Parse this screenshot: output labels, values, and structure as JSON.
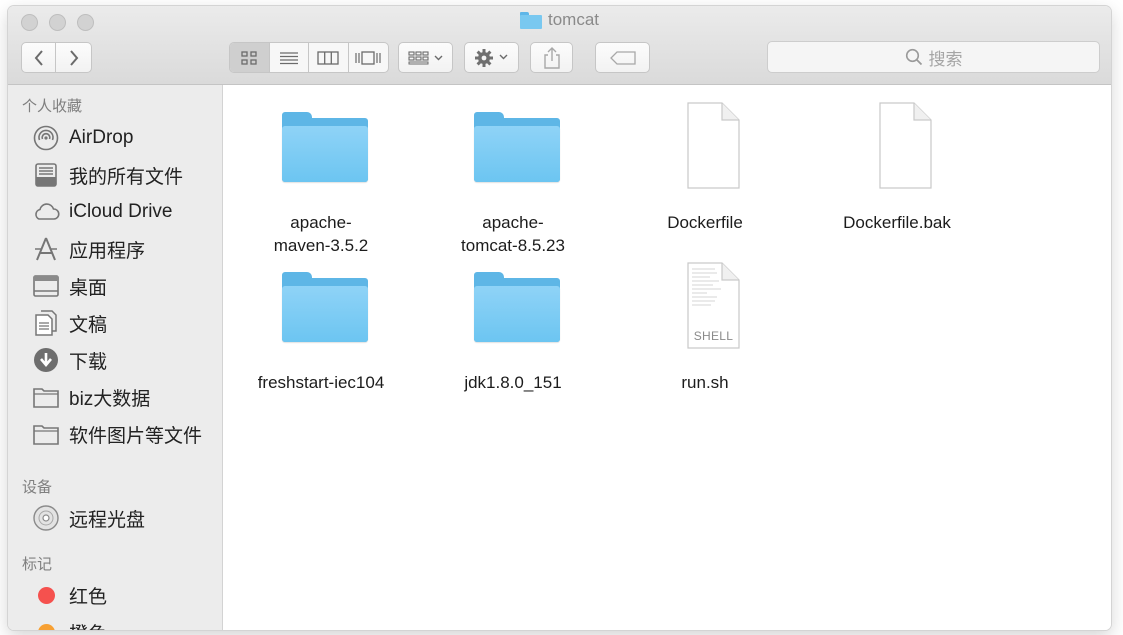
{
  "window": {
    "title": "tomcat"
  },
  "toolbar": {
    "search_placeholder": "搜索",
    "icons": {
      "back": "chevron-left-icon",
      "forward": "chevron-right-icon",
      "icon_view": "grid-view-icon",
      "list_view": "list-view-icon",
      "column_view": "column-view-icon",
      "cover_flow": "cover-flow-icon",
      "arrange": "arrange-icon",
      "action": "gear-icon",
      "share": "share-icon",
      "tags": "tag-icon",
      "search": "search-icon"
    },
    "active_view": "icon_view"
  },
  "sidebar": {
    "favorites_title": "个人收藏",
    "favorites": [
      {
        "label": "AirDrop",
        "icon": "airdrop-icon"
      },
      {
        "label": "我的所有文件",
        "icon": "all-files-icon"
      },
      {
        "label": "iCloud Drive",
        "icon": "cloud-icon"
      },
      {
        "label": "应用程序",
        "icon": "applications-icon"
      },
      {
        "label": "桌面",
        "icon": "desktop-icon"
      },
      {
        "label": "文稿",
        "icon": "documents-icon"
      },
      {
        "label": "下载",
        "icon": "download-icon"
      },
      {
        "label": "biz大数据",
        "icon": "folder-icon"
      },
      {
        "label": "软件图片等文件",
        "icon": "folder-icon"
      }
    ],
    "devices_title": "设备",
    "devices": [
      {
        "label": "远程光盘",
        "icon": "remote-disc-icon"
      }
    ],
    "tags_title": "标记",
    "tags": [
      {
        "label": "红色",
        "color": "#f5514e"
      },
      {
        "label": "橙色",
        "color": "#f7a033"
      }
    ]
  },
  "files": [
    {
      "name": "apache-\nmaven-3.5.2",
      "type": "folder"
    },
    {
      "name": "apache-\ntomcat-8.5.23",
      "type": "folder"
    },
    {
      "name": "Dockerfile",
      "type": "document"
    },
    {
      "name": "Dockerfile.bak",
      "type": "document"
    },
    {
      "name": "freshstart-iec104",
      "type": "folder"
    },
    {
      "name": "jdk1.8.0_151",
      "type": "folder"
    },
    {
      "name": "run.sh",
      "type": "shell",
      "badge": "SHELL"
    }
  ],
  "colors": {
    "folder": "#6cc5f1",
    "sidebar_bg": "#ececec",
    "titlebar_bg": "#dadada"
  }
}
